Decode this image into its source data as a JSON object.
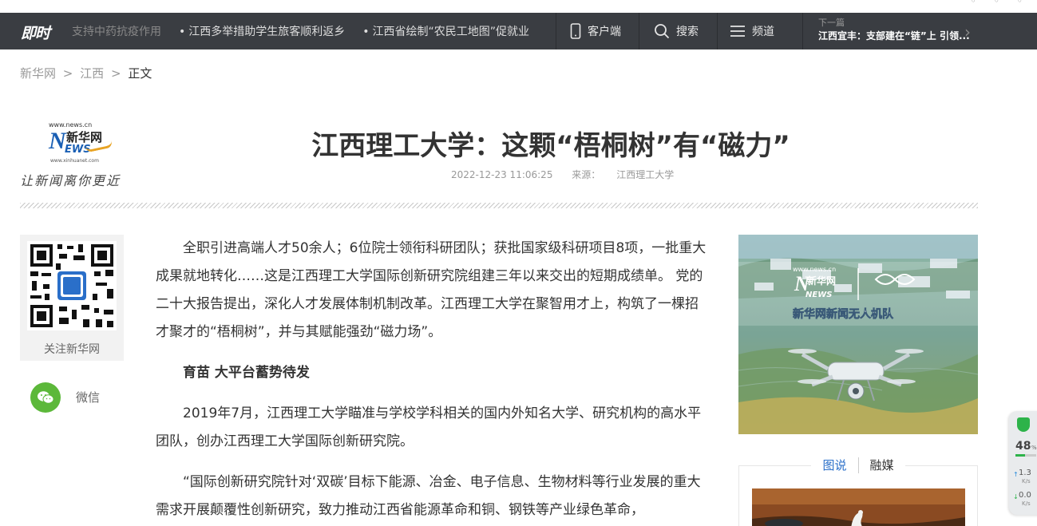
{
  "topbar": {
    "logo": "即时",
    "ticker": [
      "支持中药抗疫作用",
      "江西多举措助学生旅客顺利返乡",
      "江西省绘制“农民工地图”促就业"
    ],
    "client_label": "客户端",
    "search_label": "搜索",
    "channel_label": "频道",
    "next_label": "下一篇",
    "next_title": "江西宜丰：支部建在“链”上 引领..."
  },
  "breadcrumb": {
    "items": [
      "新华网",
      "江西"
    ],
    "current": "正文",
    "separator": ">"
  },
  "brand": {
    "url_top": "www.news.cn",
    "name_cn": "新华网",
    "name_en_n": "N",
    "name_en_rest": "EWS",
    "url_bottom": "www.xinhuanet.com",
    "slogan": "让新闻离你更近"
  },
  "article": {
    "title": "江西理工大学：这颗“梧桐树”有“磁力”",
    "datetime": "2022-12-23 11:06:25",
    "source_label": "来源：",
    "source": "江西理工大学",
    "paragraphs": [
      "全职引进高端人才50余人；6位院士领衔科研团队；获批国家级科研项目8项，一批重大成果就地转化……这是江西理工大学国际创新研究院组建三年以来交出的短期成绩单。 党的二十大报告提出，深化人才发展体制机制改革。江西理工大学在聚智用才上，构筑了一棵招才聚才的“梧桐树”，并与其赋能强劲“磁力场”。",
      "育苗 大平台蓄势待发",
      "2019年7月，江西理工大学瞄准与学校学科相关的国内外知名大学、研究机构的高水平团队，创办江西理工大学国际创新研究院。",
      "“国际创新研究院针对‘双碳’目标下能源、冶金、电子信息、生物材料等行业发展的重大需求开展颠覆性创新研究，致力推动江西省能源革命和铜、钢铁等产业绿色革命，"
    ]
  },
  "share": {
    "follow_label": "关注新华网",
    "wechat_label": "微信"
  },
  "promo": {
    "url": "www.news.cn",
    "brand_cn": "新华网",
    "brand_en": "NEWS",
    "team": "新华网新闻无人机队"
  },
  "tabs": {
    "items": [
      "图说",
      "融媒"
    ],
    "active": 0
  },
  "speed_widget": {
    "percent": "48",
    "percent_unit": "%",
    "fill": 0.48,
    "upload": "1.3",
    "download": "0.0",
    "unit": "K/s"
  },
  "colors": {
    "nav_bg": "#3a3d42",
    "accent_blue": "#2a6fc9",
    "wechat_green": "#5cb83a",
    "shield_green": "#2db34a"
  }
}
